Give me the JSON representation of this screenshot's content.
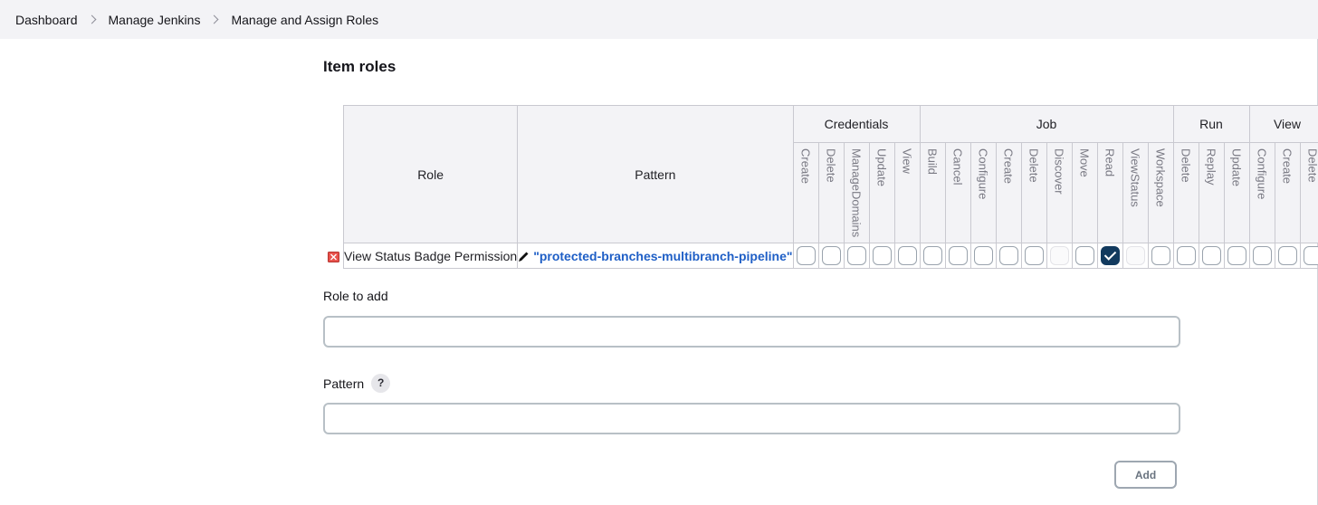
{
  "breadcrumbs": [
    "Dashboard",
    "Manage Jenkins",
    "Manage and Assign Roles"
  ],
  "section_title": "Item roles",
  "table": {
    "role_header": "Role",
    "pattern_header": "Pattern",
    "groups": [
      {
        "label": "Credentials",
        "permissions": [
          "Create",
          "Delete",
          "ManageDomains",
          "Update",
          "View"
        ]
      },
      {
        "label": "Job",
        "permissions": [
          "Build",
          "Cancel",
          "Configure",
          "Create",
          "Delete",
          "Discover",
          "Move",
          "Read",
          "ViewStatus",
          "Workspace"
        ]
      },
      {
        "label": "Run",
        "permissions": [
          "Delete",
          "Replay",
          "Update"
        ]
      },
      {
        "label": "View",
        "permissions": [
          "Configure",
          "Create",
          "Delete"
        ]
      }
    ],
    "rows": [
      {
        "role": "View Status Badge Permission",
        "pattern": "\"protected-branches-multibranch-pipeline\"",
        "states": [
          "unchecked",
          "unchecked",
          "unchecked",
          "unchecked",
          "unchecked",
          "unchecked",
          "unchecked",
          "unchecked",
          "unchecked",
          "unchecked",
          "disabled",
          "unchecked",
          "checked",
          "disabled",
          "unchecked",
          "unchecked",
          "unchecked",
          "unchecked",
          "unchecked",
          "unchecked",
          "unchecked"
        ]
      }
    ]
  },
  "role_to_add": {
    "label": "Role to add",
    "value": ""
  },
  "pattern_field": {
    "label": "Pattern",
    "help": "?",
    "value": ""
  },
  "add_button": "Add",
  "colors": {
    "checked": "#123a5e",
    "link": "#1f5fc6",
    "header_bg": "#f3f3f6"
  }
}
